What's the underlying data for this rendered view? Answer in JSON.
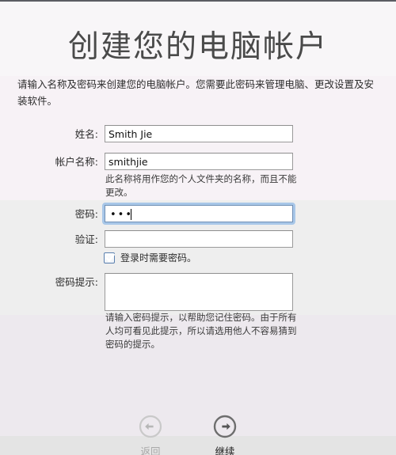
{
  "window": {
    "title": "创建您的电脑帐户"
  },
  "intro": {
    "text": "请输入名称及密码来创建您的电脑帐户。您需要此密码来管理电脑、更改设置及安装软件。"
  },
  "form": {
    "full_name": {
      "label": "姓名:",
      "value": "Smith Jie",
      "placeholder": ""
    },
    "account_name": {
      "label": "帐户名称:",
      "value": "smithjie",
      "placeholder": "",
      "helper": "此名称将用作您的个人文件夹的名称，而且不能更改。"
    },
    "password": {
      "label": "密码:",
      "value": "•••",
      "placeholder": "",
      "focused": true
    },
    "verify": {
      "label": "验证:",
      "value": "",
      "placeholder": ""
    },
    "require_password": {
      "label": "登录时需要密码。",
      "checked": true
    },
    "password_hint": {
      "label": "密码提示:",
      "value": "",
      "placeholder": "",
      "helper": "请输入密码提示，以帮助您记住密码。由于所有人均可看见此提示，所以请选用他人不容易猜到密码的提示。"
    }
  },
  "nav": {
    "back": {
      "label": "返回",
      "icon": "arrow-left-circle-icon"
    },
    "continue": {
      "label": "继续",
      "icon": "arrow-right-circle-icon"
    }
  },
  "colors": {
    "focus_ring": "#a8c7e8",
    "checkbox_border": "#5a7fae",
    "title_text": "#4a4a4a",
    "band_top": "#f8f6f8",
    "band_mid": "#eeeeee",
    "band_low": "#ede9ee",
    "band_bottom": "#e4e4e4"
  }
}
